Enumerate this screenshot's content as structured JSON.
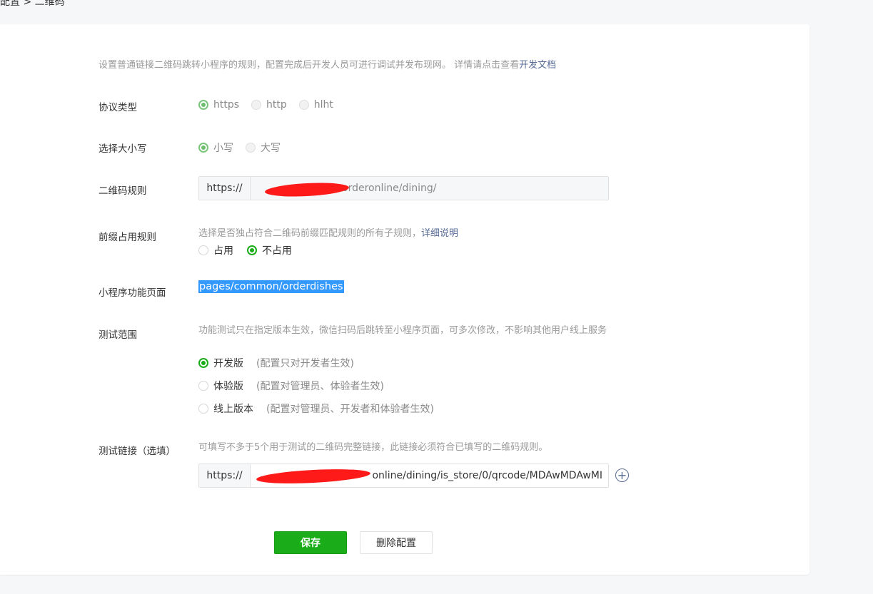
{
  "breadcrumb": "配置 > 二维码",
  "description": {
    "text": "设置普通链接二维码跳转小程序的规则，配置完成后开发人员可进行调试并发布现网。 详情请点击查看",
    "link": "开发文档"
  },
  "protocol": {
    "label": "协议类型",
    "options": [
      "https",
      "http",
      "hlht"
    ],
    "selected": "https"
  },
  "case": {
    "label": "选择大小写",
    "options": [
      "小写",
      "大写"
    ],
    "selected": "小写"
  },
  "qr_rule": {
    "label": "二维码规则",
    "prefix": "https://",
    "value": "orderonline/dining/"
  },
  "prefix_rule": {
    "label": "前缀占用规则",
    "hint": "选择是否独占符合二维码前缀匹配规则的所有子规则，",
    "hint_link": "详细说明",
    "options": [
      "占用",
      "不占用"
    ],
    "selected": "不占用"
  },
  "mini_page": {
    "label": "小程序功能页面",
    "value": "pages/common/orderdishes"
  },
  "test_scope": {
    "label": "测试范围",
    "hint": "功能测试只在指定版本生效，微信扫码后跳转至小程序页面，可多次修改，不影响其他用户线上服务",
    "options": [
      {
        "name": "开发版",
        "note": "(配置只对开发者生效)"
      },
      {
        "name": "体验版",
        "note": "(配置对管理员、体验者生效)"
      },
      {
        "name": "线上版本",
        "note": "(配置对管理员、开发者和体验者生效)"
      }
    ],
    "selected": "开发版"
  },
  "test_link": {
    "label": "测试链接（选填）",
    "hint": "可填写不多于5个用于测试的二维码完整链接，此链接必须符合已填写的二维码规则。",
    "prefix": "https://",
    "value": "online/dining/is_store/0/qrcode/MDAwMDAwMI"
  },
  "buttons": {
    "save": "保存",
    "delete": "删除配置"
  },
  "icons": {
    "add": "plus-circle-icon"
  },
  "colors": {
    "primary": "#1aad19",
    "link": "#576b95",
    "selection": "#3399ff",
    "redaction": "#ff1a1a"
  }
}
